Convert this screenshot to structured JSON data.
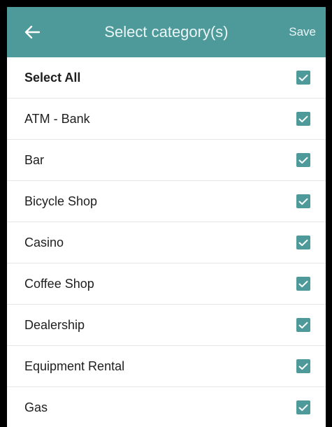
{
  "header": {
    "title": "Select category(s)",
    "save_label": "Save",
    "background_color": "#4e9a9a"
  },
  "icons": {
    "back": "arrow-left-icon",
    "check": "checkmark-icon"
  },
  "list": {
    "items": [
      {
        "label": "Select All",
        "checked": true
      },
      {
        "label": "ATM - Bank",
        "checked": true
      },
      {
        "label": "Bar",
        "checked": true
      },
      {
        "label": "Bicycle Shop",
        "checked": true
      },
      {
        "label": "Casino",
        "checked": true
      },
      {
        "label": "Coffee Shop",
        "checked": true
      },
      {
        "label": "Dealership",
        "checked": true
      },
      {
        "label": "Equipment Rental",
        "checked": true
      },
      {
        "label": "Gas",
        "checked": true
      }
    ]
  }
}
